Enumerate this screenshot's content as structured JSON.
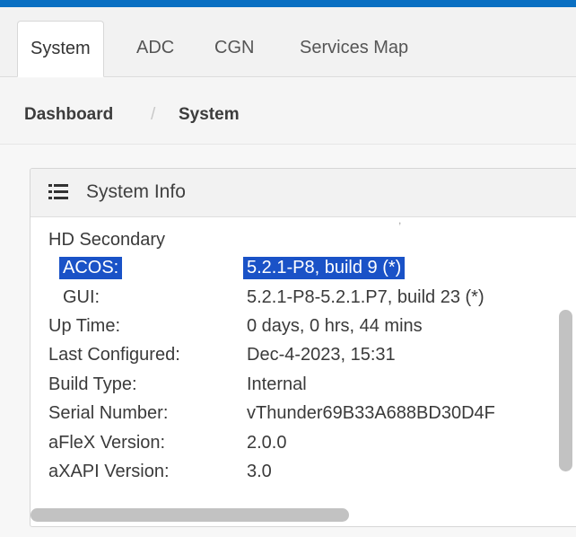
{
  "tabs": [
    "System",
    "ADC",
    "CGN",
    "Services Map"
  ],
  "breadcrumb": [
    "Dashboard",
    "System"
  ],
  "breadcrumb_separator": "/",
  "panel": {
    "title": "System Info",
    "icon": "list-icon",
    "section_heading": "HD Secondary",
    "rows": [
      {
        "label": "ACOS:",
        "value": "5.2.1-P8, build 9 (*)"
      },
      {
        "label": "GUI:",
        "value": "5.2.1-P8-5.2.1.P7, build 23 (*)"
      },
      {
        "label": "Up Time:",
        "value": "0 days, 0 hrs, 44 mins"
      },
      {
        "label": "Last Configured:",
        "value": "Dec-4-2023, 15:31"
      },
      {
        "label": "Build Type:",
        "value": "Internal"
      },
      {
        "label": "Serial Number:",
        "value": "vThunder69B33A688BD30D4F"
      },
      {
        "label": "aFleX Version:",
        "value": "2.0.0"
      },
      {
        "label": "aXAPI Version:",
        "value": "3.0"
      }
    ]
  },
  "colors": {
    "accent": "#0a6fc2",
    "selection": "#1a52c7"
  }
}
